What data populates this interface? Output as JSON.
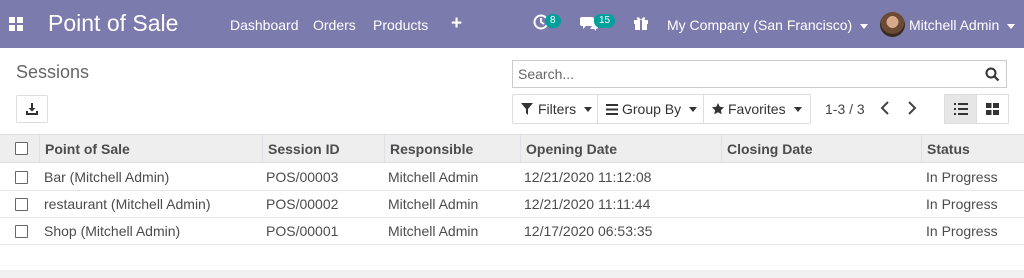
{
  "navbar": {
    "brand": "Point of Sale",
    "menu": [
      "Dashboard",
      "Orders",
      "Products"
    ],
    "activity_count": "8",
    "messages_count": "15",
    "company": "My Company (San Francisco)",
    "user": "Mitchell Admin",
    "bg_color": "#7c7bad"
  },
  "control": {
    "title": "Sessions",
    "search_placeholder": "Search...",
    "filters_label": "Filters",
    "groupby_label": "Group By",
    "favorites_label": "Favorites",
    "pager": "1-3 / 3"
  },
  "table": {
    "columns": [
      "Point of Sale",
      "Session ID",
      "Responsible",
      "Opening Date",
      "Closing Date",
      "Status"
    ],
    "rows": [
      [
        "Bar (Mitchell Admin)",
        "POS/00003",
        "Mitchell Admin",
        "12/21/2020 11:12:08",
        "",
        "In Progress"
      ],
      [
        "restaurant (Mitchell Admin)",
        "POS/00002",
        "Mitchell Admin",
        "12/21/2020 11:11:44",
        "",
        "In Progress"
      ],
      [
        "Shop (Mitchell Admin)",
        "POS/00001",
        "Mitchell Admin",
        "12/17/2020 06:53:35",
        "",
        "In Progress"
      ]
    ]
  }
}
